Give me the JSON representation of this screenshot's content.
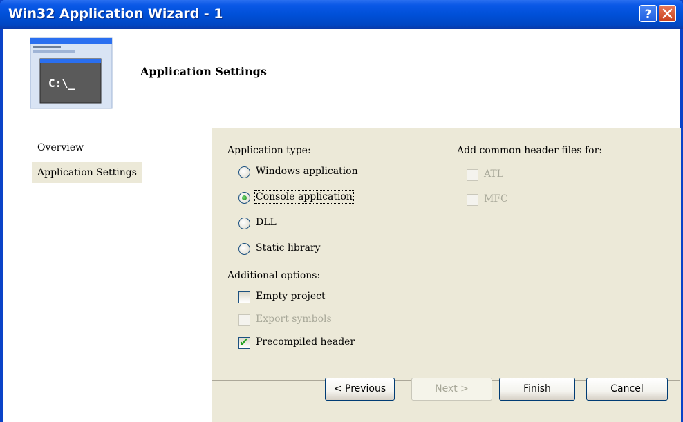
{
  "window": {
    "title": "Win32 Application Wizard - 1"
  },
  "titlebar_buttons": {
    "help": "?",
    "close": "✕"
  },
  "header": {
    "title": "Application Settings",
    "thumbnail_text": "C:\\_"
  },
  "nav": {
    "items": [
      {
        "label": "Overview",
        "selected": false
      },
      {
        "label": "Application Settings",
        "selected": true
      }
    ]
  },
  "app_type": {
    "heading": "Application type:",
    "options": [
      {
        "label": "Windows application",
        "checked": false
      },
      {
        "label": "Console application",
        "checked": true
      },
      {
        "label": "DLL",
        "checked": false
      },
      {
        "label": "Static library",
        "checked": false
      }
    ]
  },
  "additional": {
    "heading": "Additional options:",
    "options": [
      {
        "label": "Empty project",
        "checked": false,
        "enabled": true
      },
      {
        "label": "Export symbols",
        "checked": false,
        "enabled": false
      },
      {
        "label": "Precompiled header",
        "checked": true,
        "enabled": true
      }
    ]
  },
  "common_headers": {
    "heading": "Add common header files for:",
    "options": [
      {
        "label": "ATL",
        "checked": false,
        "enabled": false
      },
      {
        "label": "MFC",
        "checked": false,
        "enabled": false
      }
    ]
  },
  "buttons": {
    "previous": "< Previous",
    "next": "Next >",
    "finish": "Finish",
    "cancel": "Cancel"
  },
  "colors": {
    "titlebar": "#0a58e6",
    "dialog_bg": "#ece9d8",
    "check_green": "#21a121"
  }
}
